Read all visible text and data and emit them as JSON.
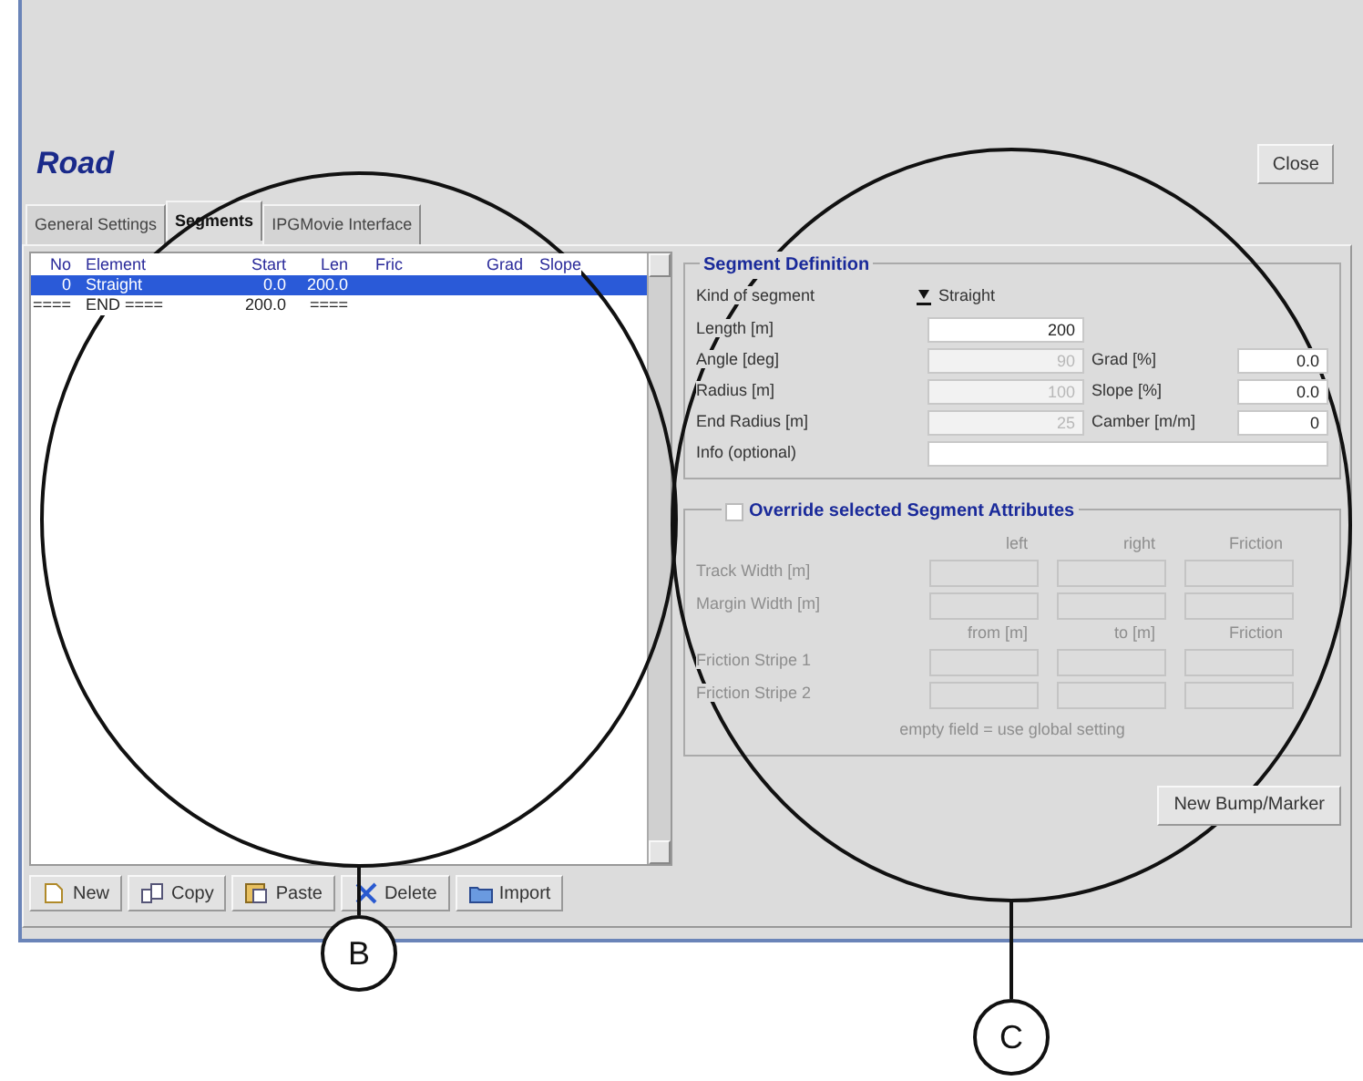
{
  "window": {
    "title": "Road",
    "close_button": "Close"
  },
  "tabs": [
    {
      "label": "General Settings",
      "selected": false
    },
    {
      "label": "Segments",
      "selected": true
    },
    {
      "label": "IPGMovie Interface",
      "selected": false
    }
  ],
  "segment_list": {
    "columns": [
      "No",
      "Element",
      "Start",
      "Len",
      "Fric",
      "Grad",
      "Slope"
    ],
    "rows": [
      {
        "cells": [
          "0",
          "Straight",
          "0.0",
          "200.0",
          "",
          "",
          ""
        ],
        "selected": true
      },
      {
        "cells": [
          "====",
          "END ====",
          "200.0",
          "====",
          "",
          "",
          ""
        ],
        "selected": false
      }
    ],
    "buttons": [
      {
        "label": "New",
        "kind": "new"
      },
      {
        "label": "Copy",
        "kind": "copy"
      },
      {
        "label": "Paste",
        "kind": "paste"
      },
      {
        "label": "Delete",
        "kind": "delete"
      },
      {
        "label": "Import",
        "kind": "import"
      }
    ]
  },
  "segment_definition": {
    "title": "Segment Definition",
    "kind_label": "Kind of segment",
    "kind_value": "Straight",
    "fields": [
      {
        "label": "Length [m]",
        "value": "200",
        "disabled": false
      },
      {
        "label": "Angle [deg]",
        "value": "90",
        "disabled": true
      },
      {
        "label": "Radius [m]",
        "value": "100",
        "disabled": true
      },
      {
        "label": "End Radius [m]",
        "value": "25",
        "disabled": true
      }
    ],
    "side_fields": [
      {
        "label": "Grad [%]",
        "value": "0.0"
      },
      {
        "label": "Slope [%]",
        "value": "0.0"
      },
      {
        "label": "Camber [m/m]",
        "value": "0"
      }
    ],
    "info_label": "Info (optional)"
  },
  "override": {
    "title": "Override selected Segment Attributes",
    "checked": false,
    "headers_1": [
      "left",
      "right",
      "Friction"
    ],
    "rows_1": [
      "Track Width [m]",
      "Margin Width [m]"
    ],
    "headers_2": [
      "from [m]",
      "to [m]",
      "Friction"
    ],
    "rows_2": [
      "Friction Stripe 1",
      "Friction Stripe 2"
    ],
    "note": "empty field = use global setting"
  },
  "bump_button": "New Bump/Marker",
  "callouts": [
    {
      "label": "B"
    },
    {
      "label": "C"
    }
  ]
}
